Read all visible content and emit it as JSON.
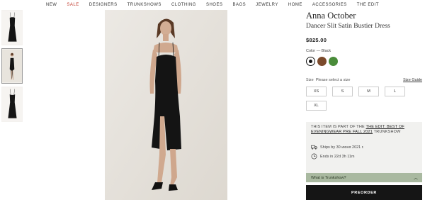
{
  "nav": {
    "items": [
      "NEW",
      "SALE",
      "DESIGNERS",
      "TRUNKSHOWS",
      "CLOTHING",
      "SHOES",
      "BAGS",
      "JEWELRY",
      "HOME",
      "ACCESSORIES",
      "THE EDIT"
    ]
  },
  "product": {
    "brand": "Anna October",
    "name": "Dancer Slit Satin Bustier Dress",
    "price": "$825.00",
    "color_label": "Color",
    "color_dash": "—",
    "color_value": "Black",
    "swatches": [
      {
        "name": "Black",
        "hex": "#111111"
      },
      {
        "name": "Brown",
        "hex": "#7b4a2c"
      },
      {
        "name": "Green",
        "hex": "#4a8c3a"
      }
    ],
    "size_label": "Size",
    "size_prompt": "Please select a size",
    "size_guide": "Size Guide",
    "sizes": [
      "XS",
      "S",
      "M",
      "L",
      "XL"
    ]
  },
  "trunkshow": {
    "intro": "THIS ITEM IS PART OF THE",
    "link": "THE EDIT: BEST OF EVENINGWEAR PRE FALL 2021",
    "suffix": "TRUNKSHOW",
    "ships": "Ships by 30 июня 2021 г.",
    "ends": "Ends in  22d  3h  11m",
    "accordion_label": "What is Trunkshow?"
  },
  "cta": {
    "preorder": "PREORDER"
  },
  "colors": {
    "accent_green": "#a9b9a0",
    "sale_red": "#c0392b",
    "button_dark": "#151515"
  }
}
